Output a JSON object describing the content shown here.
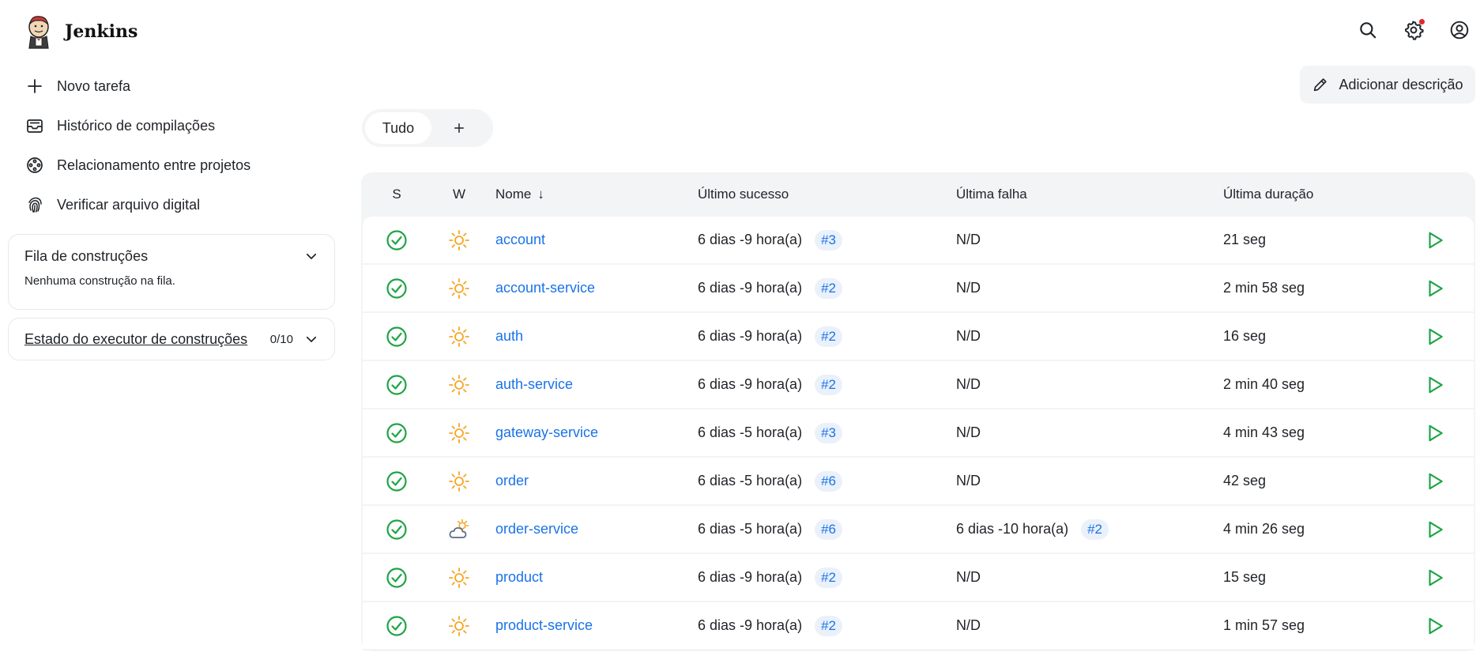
{
  "header": {
    "app_name": "Jenkins",
    "icons": [
      "search-icon",
      "settings-icon",
      "user-icon"
    ],
    "notification_color": "#e5252a"
  },
  "sidebar": {
    "items": [
      {
        "label": "Novo tarefa",
        "icon": "plus-icon"
      },
      {
        "label": "Histórico de compilações",
        "icon": "inbox-icon"
      },
      {
        "label": "Relacionamento entre projetos",
        "icon": "relationship-icon"
      },
      {
        "label": "Verificar arquivo digital",
        "icon": "fingerprint-icon"
      }
    ],
    "queue": {
      "title": "Fila de construções",
      "empty_text": "Nenhuma construção na fila."
    },
    "executor": {
      "title": "Estado do executor de construções",
      "count": "0/10"
    }
  },
  "main": {
    "add_description": "Adicionar descrição",
    "tabs": [
      {
        "label": "Tudo",
        "active": true
      }
    ],
    "table": {
      "headers": {
        "s": "S",
        "w": "W",
        "name": "Nome",
        "sort_indicator": "↓",
        "last_success": "Último sucesso",
        "last_failure": "Última falha",
        "last_duration": "Última duração"
      },
      "rows": [
        {
          "name": "account",
          "weather": "sunny",
          "success": "6 dias -9 hora(a)",
          "success_build": "#3",
          "failure": "N/D",
          "failure_build": "",
          "duration": "21 seg"
        },
        {
          "name": "account-service",
          "weather": "sunny",
          "success": "6 dias -9 hora(a)",
          "success_build": "#2",
          "failure": "N/D",
          "failure_build": "",
          "duration": "2 min 58 seg"
        },
        {
          "name": "auth",
          "weather": "sunny",
          "success": "6 dias -9 hora(a)",
          "success_build": "#2",
          "failure": "N/D",
          "failure_build": "",
          "duration": "16 seg"
        },
        {
          "name": "auth-service",
          "weather": "sunny",
          "success": "6 dias -9 hora(a)",
          "success_build": "#2",
          "failure": "N/D",
          "failure_build": "",
          "duration": "2 min 40 seg"
        },
        {
          "name": "gateway-service",
          "weather": "sunny",
          "success": "6 dias -5 hora(a)",
          "success_build": "#3",
          "failure": "N/D",
          "failure_build": "",
          "duration": "4 min 43 seg"
        },
        {
          "name": "order",
          "weather": "sunny",
          "success": "6 dias -5 hora(a)",
          "success_build": "#6",
          "failure": "N/D",
          "failure_build": "",
          "duration": "42 seg"
        },
        {
          "name": "order-service",
          "weather": "partly-cloudy",
          "success": "6 dias -5 hora(a)",
          "success_build": "#6",
          "failure": "6 dias -10 hora(a)",
          "failure_build": "#2",
          "duration": "4 min 26 seg"
        },
        {
          "name": "product",
          "weather": "sunny",
          "success": "6 dias -9 hora(a)",
          "success_build": "#2",
          "failure": "N/D",
          "failure_build": "",
          "duration": "15 seg"
        },
        {
          "name": "product-service",
          "weather": "sunny",
          "success": "6 dias -9 hora(a)",
          "success_build": "#2",
          "failure": "N/D",
          "failure_build": "",
          "duration": "1 min 57 seg"
        }
      ]
    }
  },
  "colors": {
    "success": "#1ea446",
    "sun": "#f5a623",
    "link": "#1a73e8",
    "panel_bg": "#f2f4f6"
  }
}
